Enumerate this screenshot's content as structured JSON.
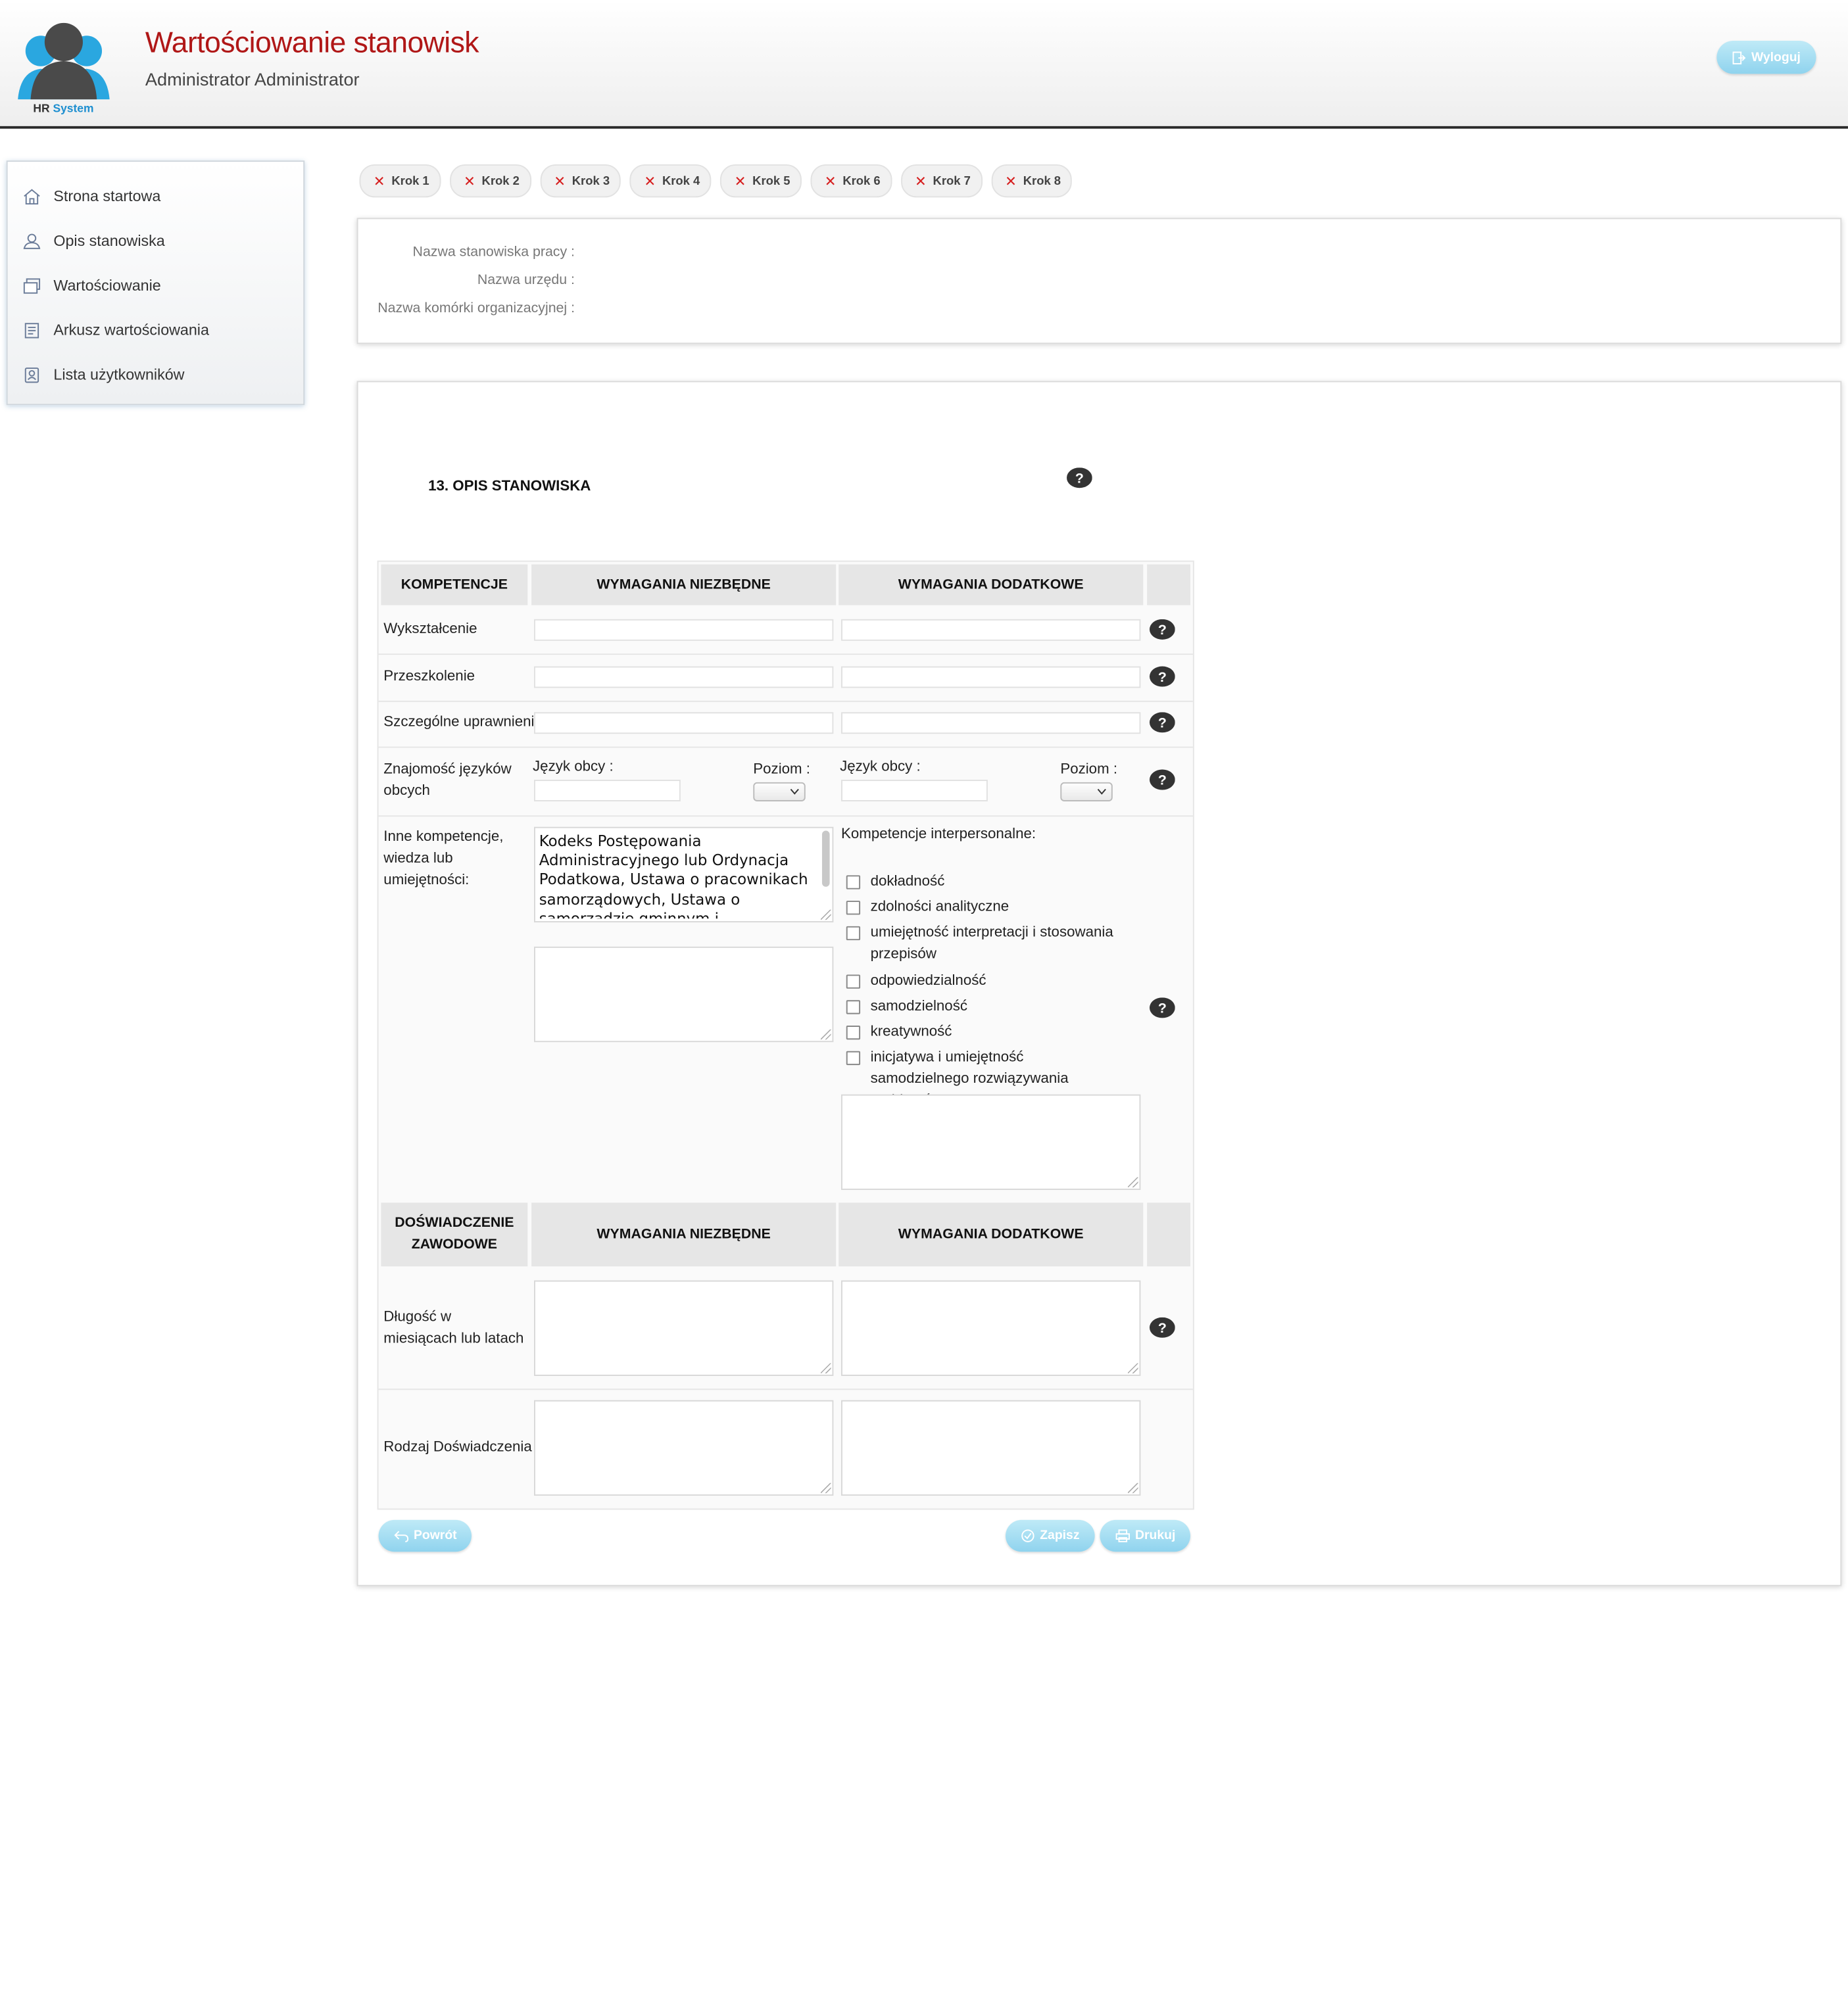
{
  "header": {
    "app_title": "Wartościowanie stanowisk",
    "user_name": "Administrator Administrator",
    "logo_text_hr": "HR",
    "logo_text_system": "System",
    "logout_label": "Wyloguj"
  },
  "sidebar": {
    "items": [
      {
        "label": "Strona startowa",
        "icon": "home-icon"
      },
      {
        "label": "Opis stanowiska",
        "icon": "person-icon"
      },
      {
        "label": "Wartościowanie",
        "icon": "window-icon"
      },
      {
        "label": "Arkusz wartościowania",
        "icon": "document-icon"
      },
      {
        "label": "Lista użytkowników",
        "icon": "users-icon"
      }
    ]
  },
  "steps": [
    "Krok 1",
    "Krok 2",
    "Krok 3",
    "Krok 4",
    "Krok 5",
    "Krok 6",
    "Krok 7",
    "Krok 8"
  ],
  "info": {
    "position_name_label": "Nazwa stanowiska pracy :",
    "office_name_label": "Nazwa urzędu :",
    "unit_name_label": "Nazwa komórki organizacyjnej :"
  },
  "form": {
    "section_title": "13. OPIS STANOWISKA",
    "competences_header": {
      "col1": "KOMPETENCJE",
      "col2": "WYMAGANIA NIEZBĘDNE",
      "col3": "WYMAGANIA DODATKOWE"
    },
    "rows": {
      "education": "Wykształcenie",
      "training": "Przeszkolenie",
      "special_permissions": "Szczególne uprawnienia",
      "languages": "Znajomość języków obcych",
      "other": "Inne kompetencje, wiedza lub umiejętności:"
    },
    "language_label": "Język obcy :",
    "level_label": "Poziom :",
    "other_required_text": "Kodeks Postępowania Administracyjnego lub Ordynacja Podatkowa, Ustawa o pracownikach samorządowych, Ustawa o samorządzie gminnym i",
    "interpersonal_title": "Kompetencje interpersonalne:",
    "interpersonal": [
      "dokładność",
      "zdolności analityczne",
      "umiejętność interpretacji i stosowania przepisów",
      "odpowiedzialność",
      "samodzielność",
      "kreatywność",
      "inicjatywa i umiejętność samodzielnego rozwiązywania problemów"
    ],
    "experience_header": {
      "col1": "DOŚWIADCZENIE ZAWODOWE",
      "col2": "WYMAGANIA NIEZBĘDNE",
      "col3": "WYMAGANIA DODATKOWE"
    },
    "experience_rows": {
      "length": "Długość w miesiącach lub latach",
      "kind": "Rodzaj Doświadczenia"
    }
  },
  "buttons": {
    "back": "Powrót",
    "save": "Zapisz",
    "print": "Drukuj"
  },
  "colors": {
    "title_red": "#b01717",
    "button_blue": "#8fd3ee",
    "step_x_red": "#d61f1f"
  }
}
